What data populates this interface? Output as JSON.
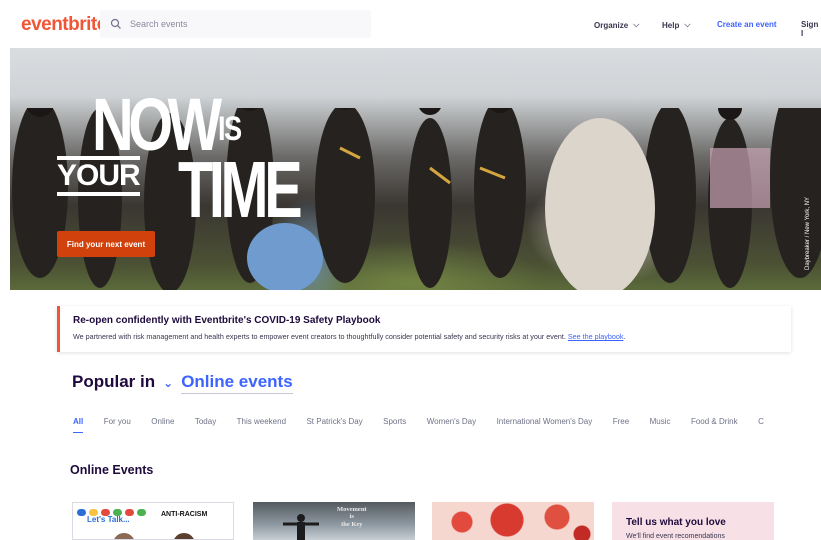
{
  "header": {
    "logo": "eventbrite",
    "search_placeholder": "Search events",
    "nav": {
      "organize": "Organize",
      "help": "Help",
      "create": "Create an event",
      "signin": "Sign I"
    }
  },
  "hero": {
    "headline": {
      "now": "NOW",
      "is": "IS",
      "your": "YOUR",
      "time": "TIME"
    },
    "cta_label": "Find your next event",
    "photo_credit": "Daybreaker / New York, NY"
  },
  "banner": {
    "title": "Re-open confidently with Eventbrite's COVID-19 Safety Playbook",
    "body": "We partnered with risk management and health experts to empower event creators to thoughtfully consider potential safety and security risks at your event.",
    "link": "See the playbook",
    "end": "."
  },
  "popular": {
    "label": "Popular in",
    "location": "Online events"
  },
  "tabs": [
    "All",
    "For you",
    "Online",
    "Today",
    "This weekend",
    "St Patrick's Day",
    "Sports",
    "Women's Day",
    "International Women's Day",
    "Free",
    "Music",
    "Food & Drink",
    "C"
  ],
  "section_title": "Online Events",
  "cards": {
    "card1": {
      "talk": "Let's Talk...",
      "anti": "ANTI-RACISM"
    },
    "card2": {
      "text": "Movement\nis\nthe Key"
    },
    "card4": {
      "title": "Tell us what you love",
      "sub": "We'll find event recomendations"
    }
  },
  "colors": {
    "brand": "#f05537",
    "accent_blue": "#3d64ff",
    "cta": "#d1410c",
    "text_dark": "#1e0a3c"
  }
}
